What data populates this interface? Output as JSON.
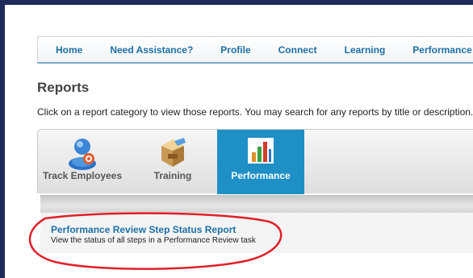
{
  "nav": {
    "items": [
      {
        "label": "Home"
      },
      {
        "label": "Need Assistance?"
      },
      {
        "label": "Profile"
      },
      {
        "label": "Connect"
      },
      {
        "label": "Learning"
      },
      {
        "label": "Performance"
      }
    ]
  },
  "page": {
    "title": "Reports",
    "instructions": "Click on a report category to view those reports. You may search for any reports by title or description."
  },
  "tabs": [
    {
      "label": "Track Employees",
      "icon": "employee-icon",
      "active": false
    },
    {
      "label": "Training",
      "icon": "training-box-icon",
      "active": false
    },
    {
      "label": "Performance",
      "icon": "bar-chart-icon",
      "active": true
    }
  ],
  "report": {
    "title": "Performance Review Step Status Report",
    "description": "View the status of all steps in a Performance Review task"
  },
  "colors": {
    "accent": "#1e90c6",
    "link": "#1d6fa6",
    "frame": "#1f2a5a",
    "annotation": "#e0202a"
  }
}
